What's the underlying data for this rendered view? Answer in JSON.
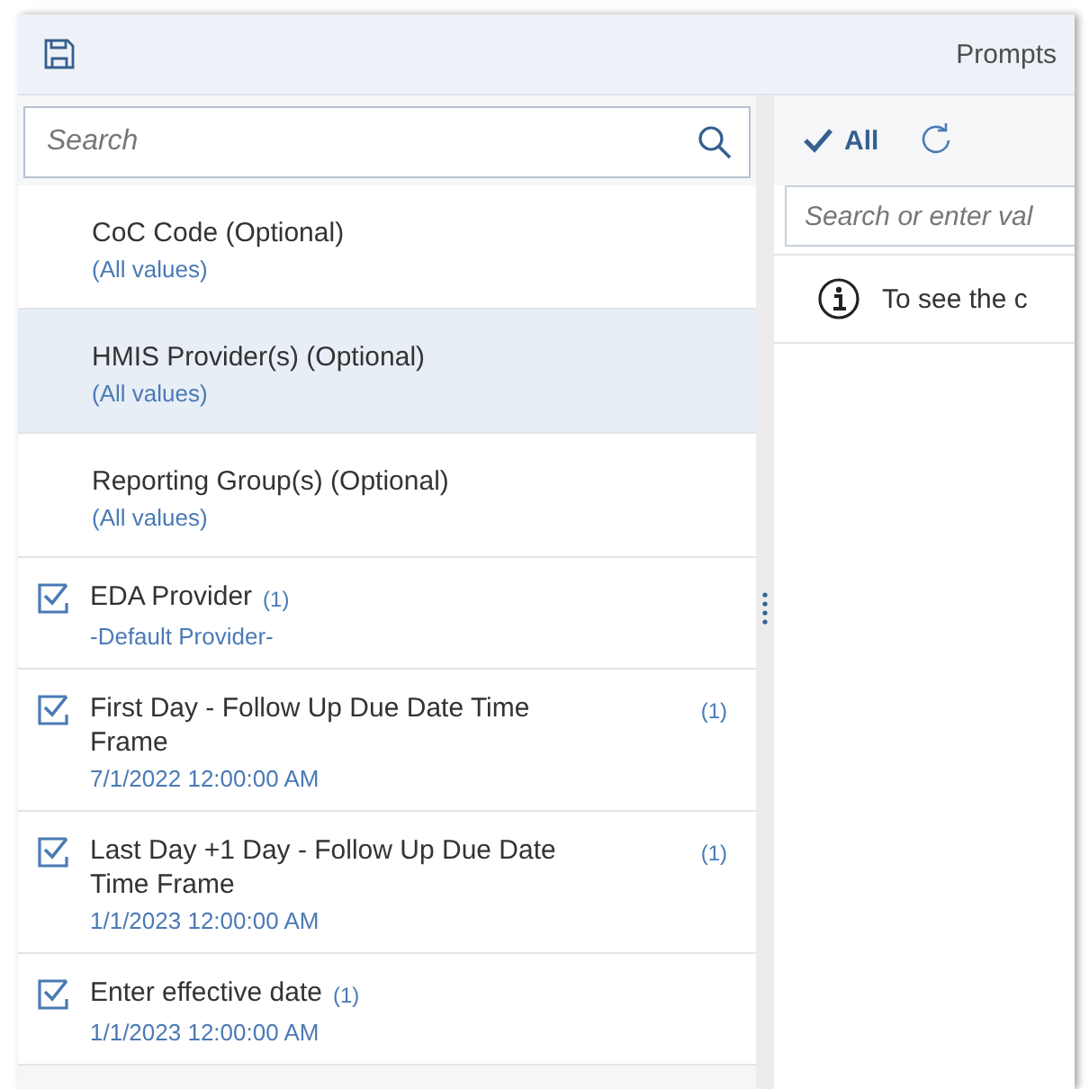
{
  "header": {
    "title": "Prompts"
  },
  "left_panel": {
    "search": {
      "placeholder": "Search"
    },
    "prompts": [
      {
        "title": "CoC Code (Optional)",
        "value": "(All values)",
        "checked": false,
        "selected": false
      },
      {
        "title": "HMIS Provider(s) (Optional)",
        "value": "(All values)",
        "checked": false,
        "selected": true
      },
      {
        "title": "Reporting Group(s) (Optional)",
        "value": "(All values)",
        "checked": false,
        "selected": false
      },
      {
        "title": "EDA Provider",
        "count": "(1)",
        "kind": "inline",
        "value": "-Default Provider-",
        "checked": true,
        "selected": false
      },
      {
        "title": "First Day - Follow Up Due Date Time Frame",
        "count": "(1)",
        "kind": "end",
        "value": "7/1/2022 12:00:00 AM",
        "checked": true,
        "selected": false
      },
      {
        "title": "Last Day +1 Day - Follow Up Due Date Time Frame",
        "count": "(1)",
        "kind": "end",
        "value": "1/1/2023 12:00:00 AM",
        "checked": true,
        "selected": false
      },
      {
        "title": "Enter effective date",
        "count": "(1)",
        "kind": "inline",
        "value": "1/1/2023 12:00:00 AM",
        "checked": true,
        "selected": false
      }
    ]
  },
  "right_panel": {
    "select_all": "All",
    "value_search": {
      "placeholder": "Search or enter val"
    },
    "info": "To see the c"
  }
}
